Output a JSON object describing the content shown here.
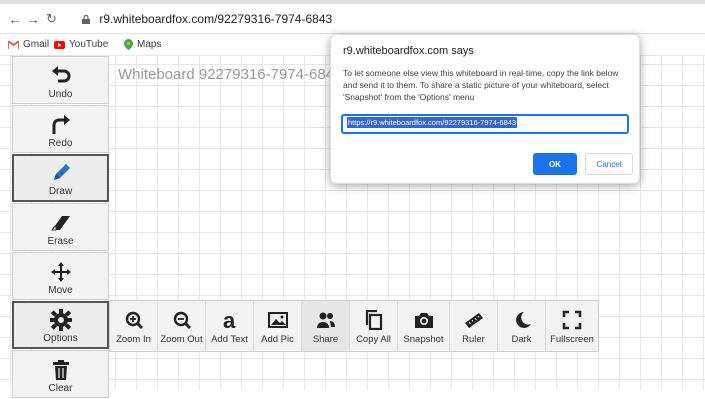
{
  "browser": {
    "url": "r9.whiteboardfox.com/92279316-7974-6843",
    "bookmarks": [
      "Gmail",
      "YouTube",
      "Maps"
    ]
  },
  "board": {
    "title": "Whiteboard 92279316-7974-6843"
  },
  "sidebar": {
    "tools": [
      {
        "label": "Undo",
        "icon": "undo-icon"
      },
      {
        "label": "Redo",
        "icon": "redo-icon"
      },
      {
        "label": "Draw",
        "icon": "pencil-icon"
      },
      {
        "label": "Erase",
        "icon": "eraser-icon"
      },
      {
        "label": "Move",
        "icon": "move-icon"
      },
      {
        "label": "Options",
        "icon": "gear-icon"
      },
      {
        "label": "Clear",
        "icon": "trash-icon"
      }
    ]
  },
  "toolbar": {
    "items": [
      {
        "label": "Zoom In",
        "icon": "zoom-in-icon"
      },
      {
        "label": "Zoom Out",
        "icon": "zoom-out-icon"
      },
      {
        "label": "Add Text",
        "icon": "text-icon"
      },
      {
        "label": "Add Pic",
        "icon": "image-icon"
      },
      {
        "label": "Share",
        "icon": "users-icon"
      },
      {
        "label": "Copy All",
        "icon": "copy-icon"
      },
      {
        "label": "Snapshot",
        "icon": "camera-icon"
      },
      {
        "label": "Ruler",
        "icon": "ruler-icon"
      },
      {
        "label": "Dark",
        "icon": "moon-icon"
      },
      {
        "label": "Fullscreen",
        "icon": "fullscreen-icon"
      }
    ]
  },
  "dialog": {
    "title": "r9.whiteboardfox.com says",
    "message": "To let someone else view this whiteboard in real-time, copy the link below and send it to them. To share a static picture of your whiteboard, select 'Snapshot' from the 'Options' menu",
    "input_value": "https://r9.whiteboardfox.com/92279316-7974-6843",
    "ok_label": "OK",
    "cancel_label": "Cancel"
  },
  "colors": {
    "accent": "#1a73e8",
    "gmail_red": "#ea4335",
    "youtube_red": "#ff0000",
    "draw_blue": "#2b6cc4"
  }
}
